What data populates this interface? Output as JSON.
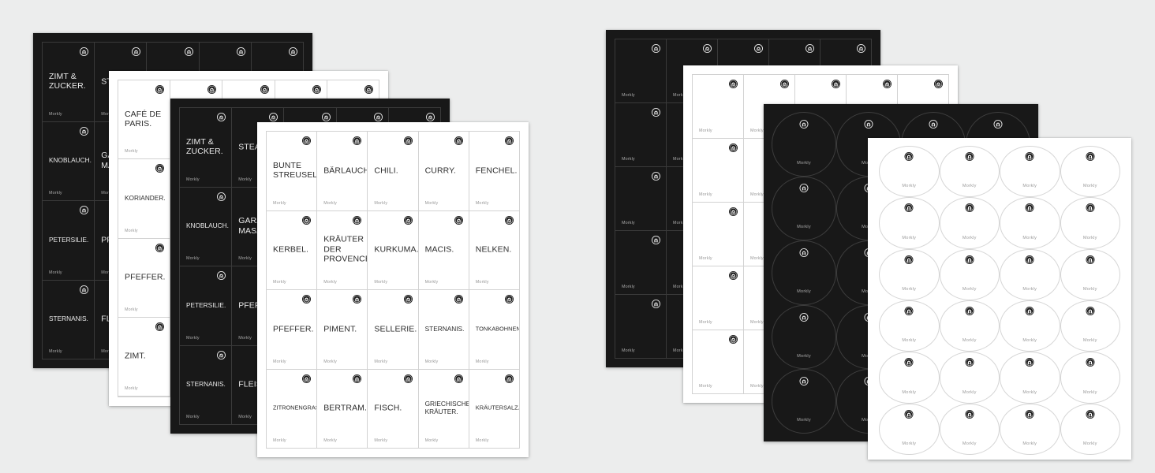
{
  "background_color": "#eceded",
  "brand": {
    "name": "Morkly",
    "logo_icon": "morkly-arch-roundel-logo"
  },
  "colors": {
    "dark_sheet": "#181818",
    "light_sheet": "#ffffff",
    "dark_cell_border": "#3a3a3a",
    "light_cell_border": "#d2d2d2",
    "dark_text": "#e9e9e9",
    "light_text": "#2d2d2d"
  },
  "sheets": [
    {
      "id": "dark-sheet-left-1",
      "name": "spice-label-sheet-dark-1",
      "theme": "dark",
      "shape": "rect",
      "columns": 5,
      "rows": 4,
      "labels": [
        "ZIMT & ZUCKER.",
        "STEAK.",
        "",
        "",
        "",
        "KNOBLAUCH.",
        "GARAM MASALA.",
        "",
        "",
        "",
        "PETERSILIE.",
        "PFEFFER.",
        "",
        "",
        "",
        "STERNANIS.",
        "FLEISCH.",
        "",
        "",
        ""
      ]
    },
    {
      "id": "light-sheet-left-2",
      "name": "spice-label-sheet-light-2",
      "theme": "light",
      "shape": "rect",
      "columns": 5,
      "rows": 5,
      "labels": [
        "CAFÉ DE PARIS.",
        "",
        "",
        "",
        "",
        "KORIANDER.",
        "",
        "",
        "",
        "",
        "PFEFFER.",
        "",
        "",
        "",
        "",
        "ZIMT.",
        "",
        "",
        "",
        ""
      ]
    },
    {
      "id": "dark-sheet-left-3",
      "name": "spice-label-sheet-dark-3",
      "theme": "dark",
      "shape": "rect",
      "columns": 5,
      "rows": 4,
      "labels": [
        "ZIMT & ZUCKER.",
        "STEAK.",
        "",
        "",
        "",
        "KNOBLAUCH.",
        "GARAM MASALA.",
        "",
        "",
        "",
        "PETERSILIE.",
        "PFEFFER.",
        "",
        "",
        "",
        "STERNANIS.",
        "FLEISCH.",
        "",
        "",
        ""
      ]
    },
    {
      "id": "light-sheet-main",
      "name": "spice-label-sheet-light-main",
      "theme": "light",
      "shape": "rect",
      "columns": 5,
      "rows": 4,
      "labels": [
        "BUNTE STREUSEL.",
        "BÄRLAUCH.",
        "CHILI.",
        "CURRY.",
        "FENCHEL.",
        "KERBEL.",
        "KRÄUTER DER PROVENCE.",
        "KURKUMA.",
        "MACIS.",
        "NELKEN.",
        "PFEFFER.",
        "PIMENT.",
        "SELLERIE.",
        "STERNANIS.",
        "TONKABOHNEN.",
        "ZITRONENGRAS.",
        "BERTRAM.",
        "FISCH.",
        "GRIECHISCHE KRÄUTER.",
        "KRÄUTERSALZ."
      ]
    },
    {
      "id": "dark-sheet-right-1",
      "name": "blank-label-sheet-dark-right",
      "theme": "dark",
      "shape": "rect",
      "columns": 5,
      "rows": 5,
      "labels": [
        "",
        "",
        "",
        "",
        "",
        "",
        "",
        "",
        "",
        "",
        "",
        "",
        "",
        "",
        "",
        "",
        "",
        "",
        "",
        "",
        "",
        "",
        "",
        "",
        ""
      ]
    },
    {
      "id": "light-sheet-right-2",
      "name": "blank-label-sheet-light-right",
      "theme": "light",
      "shape": "rect",
      "columns": 5,
      "rows": 5,
      "labels": [
        "",
        "",
        "",
        "",
        "",
        "",
        "",
        "",
        "",
        "",
        "",
        "",
        "",
        "",
        "",
        "",
        "",
        "",
        "",
        "",
        "",
        "",
        "",
        "",
        ""
      ]
    },
    {
      "id": "dark-circles-sheet",
      "name": "blank-round-sticker-sheet-dark",
      "theme": "dark",
      "shape": "circle",
      "columns": 4,
      "rows": 5
    },
    {
      "id": "light-circles-sheet",
      "name": "blank-round-sticker-sheet-light",
      "theme": "light",
      "shape": "circle",
      "columns": 4,
      "rows": 6
    }
  ]
}
